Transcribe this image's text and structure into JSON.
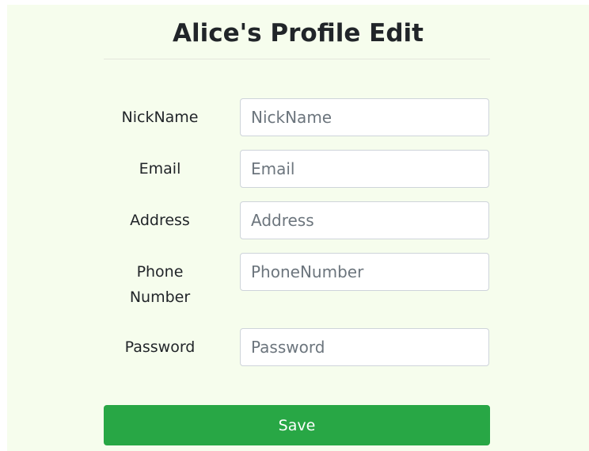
{
  "header": {
    "title": "Alice's Profile Edit"
  },
  "form": {
    "nickname": {
      "label": "NickName",
      "placeholder": "NickName",
      "value": ""
    },
    "email": {
      "label": "Email",
      "placeholder": "Email",
      "value": ""
    },
    "address": {
      "label": "Address",
      "placeholder": "Address",
      "value": ""
    },
    "phone": {
      "label_line1": "Phone",
      "label_line2": "Number",
      "placeholder": "PhoneNumber",
      "value": ""
    },
    "password": {
      "label": "Password",
      "placeholder": "Password",
      "value": ""
    }
  },
  "actions": {
    "save_label": "Save"
  },
  "colors": {
    "panel_background": "#f6fded",
    "save_button": "#28a745",
    "input_border": "#ced4da"
  }
}
